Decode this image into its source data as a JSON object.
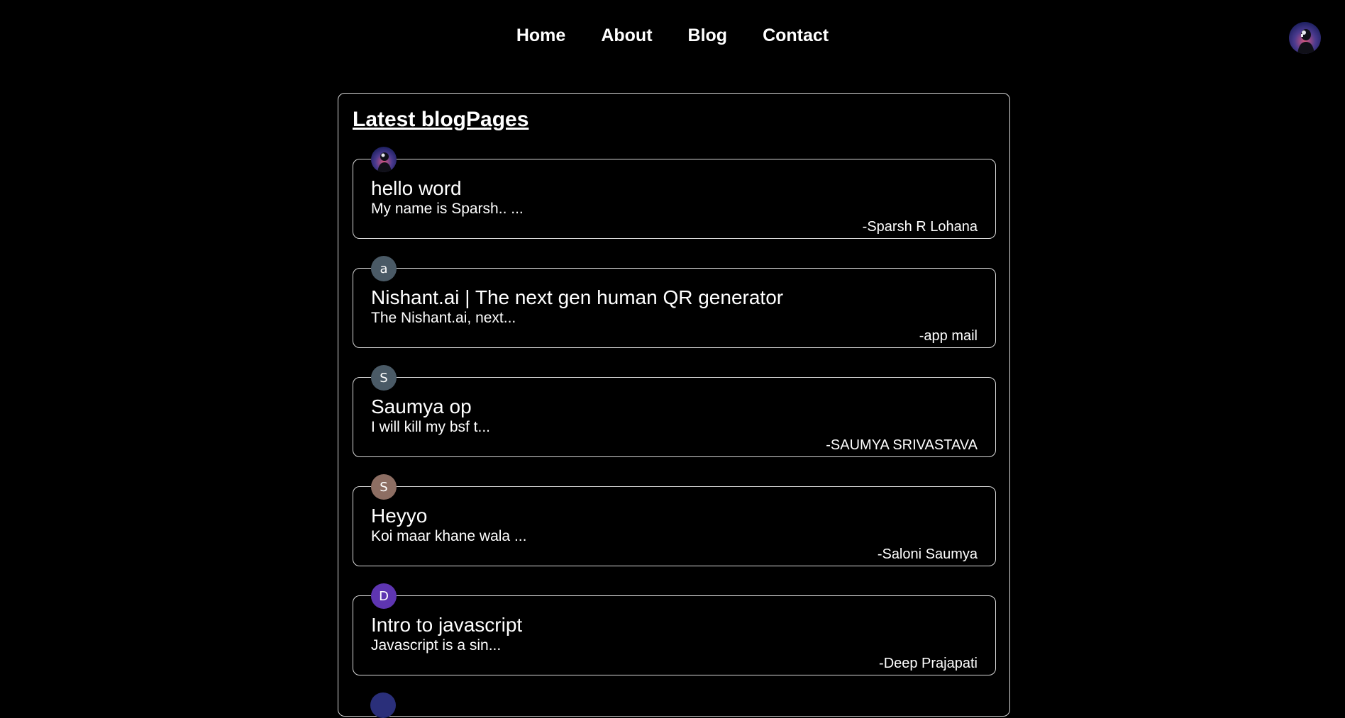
{
  "nav": {
    "links": [
      {
        "label": "Home"
      },
      {
        "label": "About"
      },
      {
        "label": "Blog"
      },
      {
        "label": "Contact"
      }
    ]
  },
  "panel": {
    "title": "Latest blogPages"
  },
  "posts": [
    {
      "title": "hello word",
      "snippet": "My name is Sparsh.. ...",
      "author": "-Sparsh R Lohana",
      "avatar_letter": "",
      "avatar_type": "photo",
      "avatar_color": "#2b2d6e"
    },
    {
      "title": "Nishant.ai | The next gen human QR generator",
      "snippet": "The Nishant.ai, next...",
      "author": "-app mail",
      "avatar_letter": "a",
      "avatar_type": "letter",
      "avatar_color": "#4a5a66"
    },
    {
      "title": "Saumya op",
      "snippet": "I will kill my bsf t...",
      "author": "-SAUMYA SRIVASTAVA",
      "avatar_letter": "S",
      "avatar_type": "letter",
      "avatar_color": "#4a5a66"
    },
    {
      "title": "Heyyo",
      "snippet": "Koi maar khane wala ...",
      "author": "-Saloni Saumya",
      "avatar_letter": "S",
      "avatar_type": "letter",
      "avatar_color": "#8d6e63"
    },
    {
      "title": "Intro to javascript",
      "snippet": "Javascript is a sin...",
      "author": "-Deep Prajapati",
      "avatar_letter": "D",
      "avatar_type": "letter",
      "avatar_color": "#5e35b1"
    }
  ]
}
